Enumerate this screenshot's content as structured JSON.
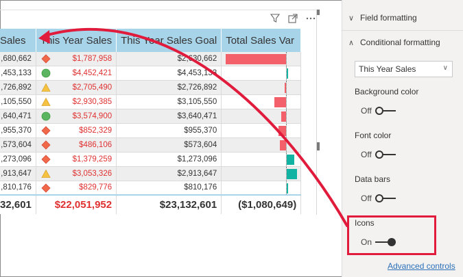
{
  "table": {
    "columns": [
      "Sales",
      "This Year Sales",
      "This Year Sales Goal",
      "Total Sales Var"
    ],
    "rows": [
      {
        "sales": ",680,662",
        "tys": "$1,787,958",
        "goal": "$2,630,662",
        "icon": "diamond-icon",
        "var": -0.65
      },
      {
        "sales": ",453,133",
        "tys": "$4,452,421",
        "goal": "$4,453,133",
        "icon": "circle-icon",
        "var": 0.0
      },
      {
        "sales": ",726,892",
        "tys": "$2,705,490",
        "goal": "$2,726,892",
        "icon": "triangle-icon",
        "var": -0.02
      },
      {
        "sales": ",105,550",
        "tys": "$2,930,385",
        "goal": "$3,105,550",
        "icon": "triangle-icon",
        "var": -0.13
      },
      {
        "sales": ",640,471",
        "tys": "$3,574,900",
        "goal": "$3,640,471",
        "icon": "circle-icon",
        "var": -0.05
      },
      {
        "sales": ",955,370",
        "tys": "$852,329",
        "goal": "$955,370",
        "icon": "diamond-icon",
        "var": -0.08
      },
      {
        "sales": ",573,604",
        "tys": "$486,106",
        "goal": "$573,604",
        "icon": "diamond-icon",
        "var": -0.07
      },
      {
        "sales": ",273,096",
        "tys": "$1,379,259",
        "goal": "$1,273,096",
        "icon": "diamond-icon",
        "var": 0.08
      },
      {
        "sales": ",913,647",
        "tys": "$3,053,326",
        "goal": "$2,913,647",
        "icon": "triangle-icon",
        "var": 0.11
      },
      {
        "sales": ",810,176",
        "tys": "$829,776",
        "goal": "$810,176",
        "icon": "diamond-icon",
        "var": 0.015
      }
    ],
    "total": {
      "sales": "32,601",
      "tys": "$22,051,952",
      "goal": "$23,132,601",
      "var": "($1,080,649)"
    }
  },
  "pane": {
    "field_formatting": "Field formatting",
    "conditional_formatting": "Conditional formatting",
    "field_select": "This Year Sales",
    "background_color": {
      "label": "Background color",
      "state": "Off"
    },
    "font_color": {
      "label": "Font color",
      "state": "Off"
    },
    "data_bars": {
      "label": "Data bars",
      "state": "Off"
    },
    "icons": {
      "label": "Icons",
      "state": "On"
    },
    "advanced_controls": "Advanced controls"
  },
  "colors": {
    "header_bg": "#a8d4ea",
    "negative_bar": "#f4606a",
    "positive_bar": "#13b3a4",
    "negative_text": "#e03030",
    "highlight": "#e01b3c",
    "icon_red": "#f06a4a",
    "icon_green": "#5bb560",
    "icon_yellow": "#f5c242"
  }
}
